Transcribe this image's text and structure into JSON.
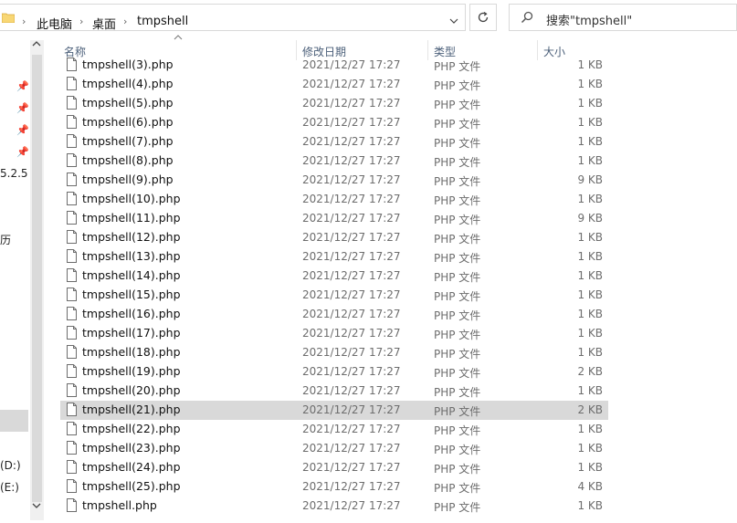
{
  "address": {
    "crumbs": [
      "此电脑",
      "桌面",
      "tmpshell"
    ],
    "separator": "›",
    "dropdown": "⌄"
  },
  "search": {
    "placeholder": "搜索\"tmpshell\""
  },
  "nav": {
    "fragments": [
      "5.2.5",
      "历",
      "(D:)",
      "(E:)"
    ]
  },
  "columns": {
    "name": "名称",
    "date": "修改日期",
    "type": "类型",
    "size": "大小"
  },
  "files": [
    {
      "name": "tmpshell(3).php",
      "date": "2021/12/27 17:27",
      "type": "PHP 文件",
      "size": "1 KB"
    },
    {
      "name": "tmpshell(4).php",
      "date": "2021/12/27 17:27",
      "type": "PHP 文件",
      "size": "1 KB"
    },
    {
      "name": "tmpshell(5).php",
      "date": "2021/12/27 17:27",
      "type": "PHP 文件",
      "size": "1 KB"
    },
    {
      "name": "tmpshell(6).php",
      "date": "2021/12/27 17:27",
      "type": "PHP 文件",
      "size": "1 KB"
    },
    {
      "name": "tmpshell(7).php",
      "date": "2021/12/27 17:27",
      "type": "PHP 文件",
      "size": "1 KB"
    },
    {
      "name": "tmpshell(8).php",
      "date": "2021/12/27 17:27",
      "type": "PHP 文件",
      "size": "1 KB"
    },
    {
      "name": "tmpshell(9).php",
      "date": "2021/12/27 17:27",
      "type": "PHP 文件",
      "size": "9 KB"
    },
    {
      "name": "tmpshell(10).php",
      "date": "2021/12/27 17:27",
      "type": "PHP 文件",
      "size": "1 KB"
    },
    {
      "name": "tmpshell(11).php",
      "date": "2021/12/27 17:27",
      "type": "PHP 文件",
      "size": "9 KB"
    },
    {
      "name": "tmpshell(12).php",
      "date": "2021/12/27 17:27",
      "type": "PHP 文件",
      "size": "1 KB"
    },
    {
      "name": "tmpshell(13).php",
      "date": "2021/12/27 17:27",
      "type": "PHP 文件",
      "size": "1 KB"
    },
    {
      "name": "tmpshell(14).php",
      "date": "2021/12/27 17:27",
      "type": "PHP 文件",
      "size": "1 KB"
    },
    {
      "name": "tmpshell(15).php",
      "date": "2021/12/27 17:27",
      "type": "PHP 文件",
      "size": "1 KB"
    },
    {
      "name": "tmpshell(16).php",
      "date": "2021/12/27 17:27",
      "type": "PHP 文件",
      "size": "1 KB"
    },
    {
      "name": "tmpshell(17).php",
      "date": "2021/12/27 17:27",
      "type": "PHP 文件",
      "size": "1 KB"
    },
    {
      "name": "tmpshell(18).php",
      "date": "2021/12/27 17:27",
      "type": "PHP 文件",
      "size": "1 KB"
    },
    {
      "name": "tmpshell(19).php",
      "date": "2021/12/27 17:27",
      "type": "PHP 文件",
      "size": "2 KB"
    },
    {
      "name": "tmpshell(20).php",
      "date": "2021/12/27 17:27",
      "type": "PHP 文件",
      "size": "1 KB"
    },
    {
      "name": "tmpshell(21).php",
      "date": "2021/12/27 17:27",
      "type": "PHP 文件",
      "size": "2 KB",
      "selected": true
    },
    {
      "name": "tmpshell(22).php",
      "date": "2021/12/27 17:27",
      "type": "PHP 文件",
      "size": "1 KB"
    },
    {
      "name": "tmpshell(23).php",
      "date": "2021/12/27 17:27",
      "type": "PHP 文件",
      "size": "1 KB"
    },
    {
      "name": "tmpshell(24).php",
      "date": "2021/12/27 17:27",
      "type": "PHP 文件",
      "size": "1 KB"
    },
    {
      "name": "tmpshell(25).php",
      "date": "2021/12/27 17:27",
      "type": "PHP 文件",
      "size": "4 KB"
    },
    {
      "name": "tmpshell.php",
      "date": "2021/12/27 17:27",
      "type": "PHP 文件",
      "size": "1 KB"
    }
  ],
  "colors": {
    "selected_row": "#d9d9d9",
    "header_text": "#4c607a",
    "muted_text": "#6d6d6d",
    "folder": "#f8d775"
  }
}
